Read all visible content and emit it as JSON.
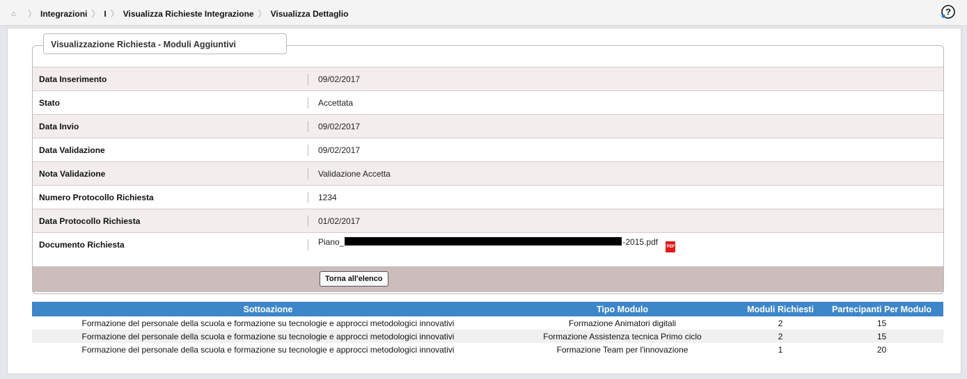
{
  "breadcrumb": {
    "items": [
      "Integrazioni",
      "I",
      "Visualizza Richieste Integrazione",
      "Visualizza Dettaglio"
    ]
  },
  "fieldset": {
    "legend": "Visualizzazione Richiesta - Moduli Aggiuntivi"
  },
  "details": [
    {
      "label": "Data Inserimento",
      "value": "09/02/2017"
    },
    {
      "label": "Stato",
      "value": "Accettata"
    },
    {
      "label": "Data Invio",
      "value": "09/02/2017"
    },
    {
      "label": "Data Validazione",
      "value": "09/02/2017"
    },
    {
      "label": "Nota Validazione",
      "value": "Validazione Accetta"
    },
    {
      "label": "Numero Protocollo Richiesta",
      "value": "1234"
    },
    {
      "label": "Data Protocollo Richiesta",
      "value": "01/02/2017"
    }
  ],
  "document": {
    "label": "Documento Richiesta",
    "prefix": "Piano_",
    "suffix": "-2015.pdf",
    "icon": "pdf-icon",
    "icon_text": "PDF"
  },
  "back_button": "Torna all'elenco",
  "grid": {
    "headers": [
      "Sottoazione",
      "Tipo Modulo",
      "Moduli Richiesti",
      "Partecipanti Per Modulo"
    ],
    "rows": [
      [
        "Formazione del personale della scuola e formazione su tecnologie e approcci metodologici innovativi",
        "Formazione Animatori digitali",
        "2",
        "15"
      ],
      [
        "Formazione del personale della scuola e formazione su tecnologie e approcci metodologici innovativi",
        "Formazione Assistenza tecnica Primo ciclo",
        "2",
        "15"
      ],
      [
        "Formazione del personale della scuola e formazione su tecnologie e approcci metodologici innovativi",
        "Formazione Team per l'innovazione",
        "1",
        "20"
      ]
    ]
  },
  "colors": {
    "header_blue": "#3d86c9",
    "row_alt": "#f3eded",
    "button_bar": "#ccbcbc"
  }
}
